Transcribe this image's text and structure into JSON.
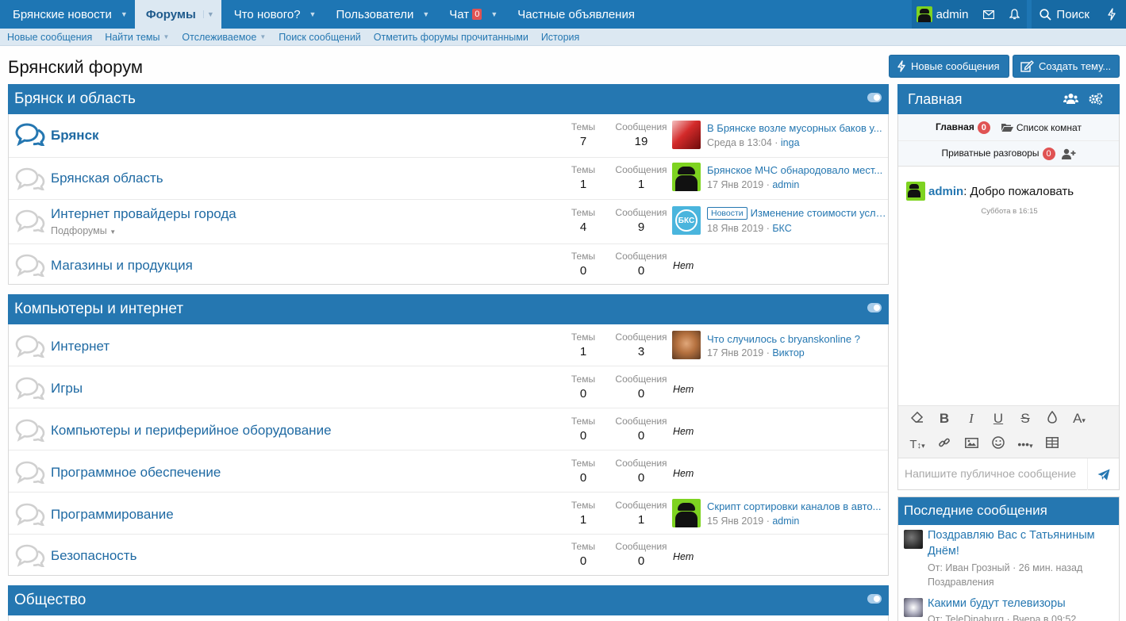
{
  "nav": {
    "items": [
      {
        "label": "Брянские новости",
        "has_caret": true
      },
      {
        "label": "Форумы",
        "has_caret": true,
        "active": true
      },
      {
        "label": "Что нового?",
        "has_caret": true
      },
      {
        "label": "Пользователи",
        "has_caret": true
      },
      {
        "label": "Чат",
        "badge": "0",
        "has_caret": true
      },
      {
        "label": "Частные объявления",
        "has_caret": false
      }
    ],
    "username": "admin",
    "search_label": "Поиск"
  },
  "subnav": {
    "items": [
      {
        "label": "Новые сообщения"
      },
      {
        "label": "Найти темы",
        "has_caret": true
      },
      {
        "label": "Отслеживаемое",
        "has_caret": true
      },
      {
        "label": "Поиск сообщений"
      },
      {
        "label": "Отметить форумы прочитанными"
      },
      {
        "label": "История"
      }
    ]
  },
  "page": {
    "title": "Брянский форум",
    "new_posts_button": "Новые сообщения",
    "create_thread_button": "Создать тему..."
  },
  "labels": {
    "threads": "Темы",
    "messages": "Сообщения",
    "none": "Нет"
  },
  "categories": [
    {
      "title": "Брянск и область",
      "nodes": [
        {
          "title": "Брянск",
          "unread": true,
          "threads": "7",
          "messages": "19",
          "last": {
            "avatar": "red",
            "title": "В Брянске возле мусорных баков у...",
            "date": "Среда в 13:04",
            "user": "inga"
          }
        },
        {
          "title": "Брянская область",
          "threads": "1",
          "messages": "1",
          "last": {
            "avatar": "alien",
            "title": "Брянское МЧС обнародовало мест...",
            "date": "17 Янв 2019",
            "user": "admin"
          }
        },
        {
          "title": "Интернет провайдеры города",
          "sub": "Подфорумы",
          "threads": "4",
          "messages": "9",
          "last": {
            "avatar": "bks",
            "prefix": "Новости",
            "title": "Изменение стоимости услу...",
            "date": "18 Янв 2019",
            "user": "БКС"
          }
        },
        {
          "title": "Магазины и продукция",
          "threads": "0",
          "messages": "0",
          "last": null
        }
      ]
    },
    {
      "title": "Компьютеры и интернет",
      "nodes": [
        {
          "title": "Интернет",
          "threads": "1",
          "messages": "3",
          "last": {
            "avatar": "face",
            "title": "Что случилось с bryanskonline ?",
            "date": "17 Янв 2019",
            "user": "Виктор"
          }
        },
        {
          "title": "Игры",
          "threads": "0",
          "messages": "0",
          "last": null
        },
        {
          "title": "Компьютеры и периферийное оборудование",
          "threads": "0",
          "messages": "0",
          "last": null
        },
        {
          "title": "Программное обеспечение",
          "threads": "0",
          "messages": "0",
          "last": null
        },
        {
          "title": "Программирование",
          "threads": "1",
          "messages": "1",
          "last": {
            "avatar": "alien",
            "title": "Скрипт сортировки каналов в авто...",
            "date": "15 Янв 2019",
            "user": "admin"
          }
        },
        {
          "title": "Безопасность",
          "threads": "0",
          "messages": "0",
          "last": null
        }
      ]
    },
    {
      "title": "Общество",
      "nodes": []
    }
  ],
  "chat": {
    "title": "Главная",
    "tab_main": "Главная",
    "tab_main_badge": "0",
    "tab_rooms": "Список комнат",
    "tab_private": "Приватные разговоры",
    "tab_private_badge": "0",
    "message_user": "admin",
    "message_text": ": Добро пожаловать",
    "message_time": "Суббота в 16:15",
    "input_placeholder": "Напишите публичное сообщение"
  },
  "latest": {
    "title": "Последние сообщения",
    "posts": [
      {
        "avatar": "dark",
        "title": "Поздравляю Вас с Татьяниным Днём!",
        "meta": "От: Иван Грозный · 26 мин. назад",
        "forum": "Поздравления"
      },
      {
        "avatar": "tv",
        "title": "Какими будут телевизоры",
        "meta": "От: TeleDinaburg · Вчера в 09:52",
        "forum": ""
      }
    ]
  }
}
